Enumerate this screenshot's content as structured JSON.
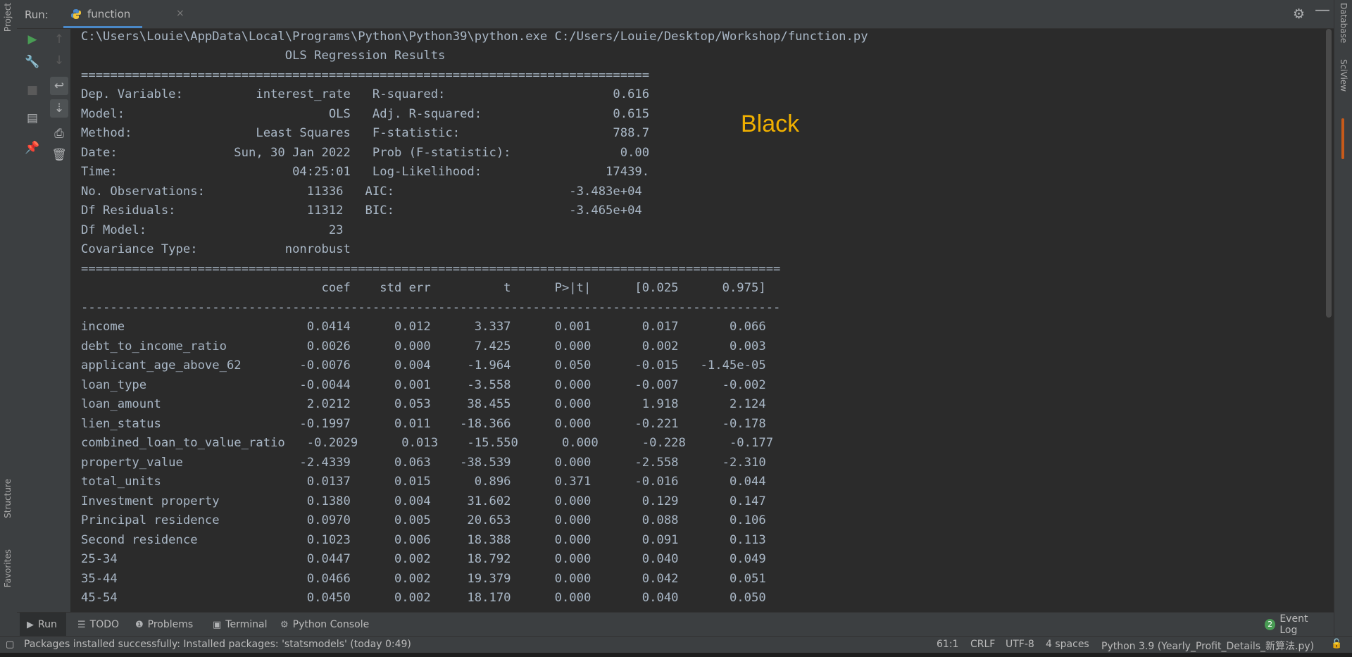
{
  "run_panel": {
    "label": "Run:",
    "tab_label": "function",
    "tab_close": "×"
  },
  "left_strip": {
    "project": "Project",
    "structure": "Structure",
    "favorites": "Favorites"
  },
  "right_strip": {
    "database": "Database",
    "sciview": "SciView"
  },
  "console": {
    "command": "C:\\Users\\Louie\\AppData\\Local\\Programs\\Python\\Python39\\python.exe C:/Users/Louie/Desktop/Workshop/function.py",
    "title": "                            OLS Regression Results",
    "sep_eq_short": "==============================================================================",
    "summary": [
      "Dep. Variable:          interest_rate   R-squared:                       0.616",
      "Model:                            OLS   Adj. R-squared:                  0.615",
      "Method:                 Least Squares   F-statistic:                     788.7",
      "Date:                Sun, 30 Jan 2022   Prob (F-statistic):               0.00",
      "Time:                        04:25:01   Log-Likelihood:                 17439.",
      "No. Observations:              11336   AIC:                        -3.483e+04",
      "Df Residuals:                  11312   BIC:                        -3.465e+04",
      "Df Model:                         23",
      "Covariance Type:            nonrobust"
    ],
    "sep_eq_long": "================================================================================================",
    "coef_header": "                                 coef    std err          t      P>|t|      [0.025      0.975]",
    "sep_dash": "------------------------------------------------------------------------------------------------",
    "rows": [
      "income                         0.0414      0.012      3.337      0.001       0.017       0.066",
      "debt_to_income_ratio           0.0026      0.000      7.425      0.000       0.002       0.003",
      "applicant_age_above_62        -0.0076      0.004     -1.964      0.050      -0.015   -1.45e-05",
      "loan_type                     -0.0044      0.001     -3.558      0.000      -0.007      -0.002",
      "loan_amount                    2.0212      0.053     38.455      0.000       1.918       2.124",
      "lien_status                   -0.1997      0.011    -18.366      0.000      -0.221      -0.178",
      "combined_loan_to_value_ratio   -0.2029      0.013    -15.550      0.000      -0.228      -0.177",
      "property_value                -2.4339      0.063    -38.539      0.000      -2.558      -2.310",
      "total_units                    0.0137      0.015      0.896      0.371      -0.016       0.044",
      "Investment property            0.1380      0.004     31.602      0.000       0.129       0.147",
      "Principal residence            0.0970      0.005     20.653      0.000       0.088       0.106",
      "Second residence               0.1023      0.006     18.388      0.000       0.091       0.113",
      "25-34                          0.0447      0.002     18.792      0.000       0.040       0.049",
      "35-44                          0.0466      0.002     19.379      0.000       0.042       0.051",
      "45-54                          0.0450      0.002     18.170      0.000       0.040       0.050"
    ],
    "annotation": "Black"
  },
  "bottom_tabs": {
    "run": "Run",
    "todo": "TODO",
    "problems": "Problems",
    "terminal": "Terminal",
    "python_console": "Python Console",
    "event_log": "Event Log",
    "event_count": "2"
  },
  "status_bar": {
    "message": "Packages installed successfully: Installed packages: 'statsmodels' (today 0:49)",
    "position": "61:1",
    "line_sep": "CRLF",
    "encoding": "UTF-8",
    "indent": "4 spaces",
    "interpreter": "Python 3.9 (Yearly_Profit_Details_新算法.py)"
  },
  "colors": {
    "accent": "#4a88c7",
    "annotation": "#f0b000",
    "run_green": "#499c54"
  }
}
